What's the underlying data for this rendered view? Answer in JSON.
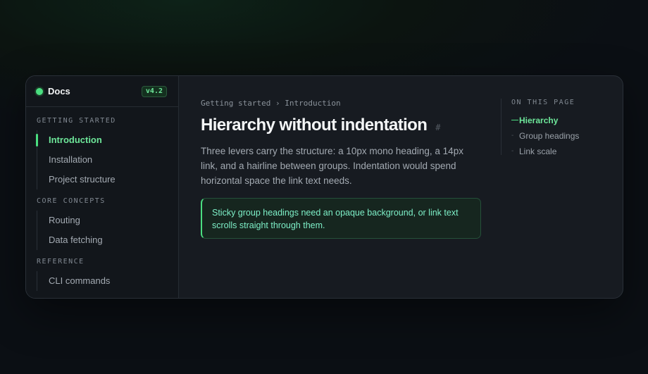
{
  "sidebar": {
    "brand": "Docs",
    "version": "v4.2",
    "groups": [
      {
        "heading": "GETTING STARTED",
        "items": [
          "Introduction",
          "Installation",
          "Project structure"
        ]
      },
      {
        "heading": "CORE CONCEPTS",
        "items": [
          "Routing",
          "Data fetching"
        ]
      },
      {
        "heading": "REFERENCE",
        "items": [
          "CLI commands"
        ]
      }
    ],
    "active_item": "Introduction"
  },
  "main": {
    "breadcrumb": "Getting started › Introduction",
    "title": "Hierarchy without indentation",
    "anchor": "#",
    "intro": "Three levers carry the structure: a 10px mono heading, a 14px link, and a hairline between groups. Indentation would spend horizontal space the link text needs.",
    "callout": "Sticky group headings need an opaque background, or link text scrolls straight through them."
  },
  "toc": {
    "heading": "ON THIS PAGE",
    "items": [
      "Hierarchy",
      "Group headings",
      "Link scale"
    ],
    "active_item": "Hierarchy"
  },
  "colors": {
    "accent": "#4ade80",
    "background": "#0b0f14",
    "panel": "#171b21",
    "callout_text": "#7ef0c8"
  }
}
